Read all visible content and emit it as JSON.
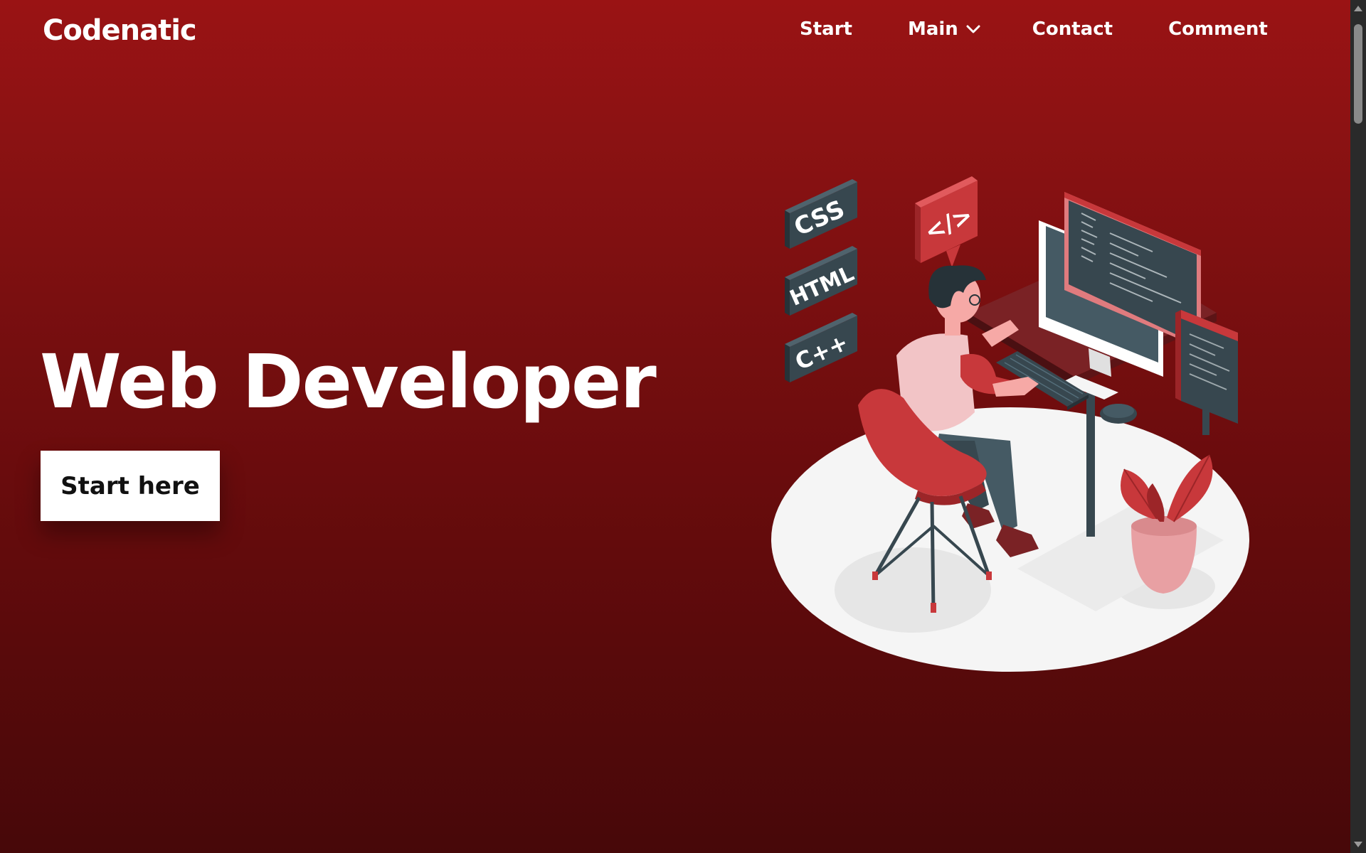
{
  "header": {
    "logo": "Codenatic",
    "nav": [
      {
        "label": "Start"
      },
      {
        "label": "Main",
        "has_dropdown": true
      },
      {
        "label": "Contact"
      },
      {
        "label": "Comment"
      }
    ]
  },
  "hero": {
    "title": "Web Developer",
    "cta_label": "Start here"
  },
  "illustration": {
    "tags": [
      "CSS",
      "HTML",
      "C++"
    ],
    "bubble_text": "</>"
  },
  "colors": {
    "background_top": "#9a1314",
    "background_bottom": "#470809",
    "accent_red": "#c8383b",
    "dark_slate": "#37474f",
    "floor": "#f5f5f5"
  },
  "icons": {
    "main_dropdown": "chevron-down-icon"
  }
}
